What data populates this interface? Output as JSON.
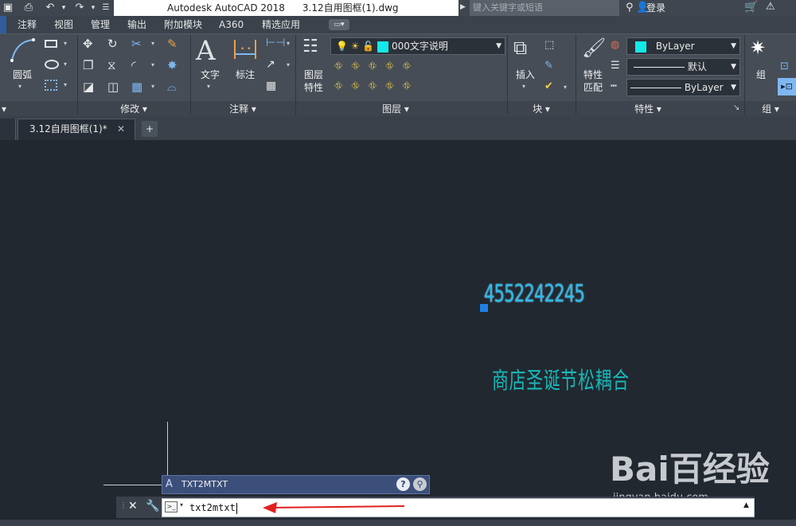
{
  "titlebar": {
    "app": "Autodesk AutoCAD 2018",
    "file": "3.12自用图框(1).dwg",
    "search_placeholder": "键入关键字或短语",
    "login": "登录"
  },
  "menu": [
    "注释",
    "视图",
    "管理",
    "输出",
    "附加模块",
    "A360",
    "精选应用"
  ],
  "ribbon": {
    "draw": {
      "arc": "圆弧"
    },
    "modify": {
      "title": "修改"
    },
    "annotation": {
      "title": "注释",
      "text": "文字",
      "dimension": "标注"
    },
    "layers": {
      "title": "图层",
      "layer_props": "图层\n特性",
      "layer_props_1": "图层",
      "layer_props_2": "特性",
      "current_layer": "000文字说明"
    },
    "block": {
      "title": "块",
      "insert": "插入"
    },
    "properties": {
      "title": "特性",
      "match": "特性\n匹配",
      "match_1": "特性",
      "match_2": "匹配",
      "color": "ByLayer",
      "linetype": "默认",
      "lineweight": "ByLayer"
    },
    "groups": {
      "title": "组",
      "group": "组"
    }
  },
  "tabs": {
    "document": "3.12自用图框(1)*",
    "add": "+"
  },
  "canvas": {
    "number_text": "4552242245",
    "chinese_text": "商店圣诞节松耦合"
  },
  "command": {
    "history": "TXT2MTXT",
    "input": "txt2mtxt"
  },
  "watermark": {
    "brand": "Bai百经验",
    "url": "jingyan.baidu.com"
  },
  "colors": {
    "accent_cyan": "#14e8e8",
    "text_blue": "#2fb8e6",
    "text_teal": "#19b7b7",
    "arrow": "#e02020"
  }
}
